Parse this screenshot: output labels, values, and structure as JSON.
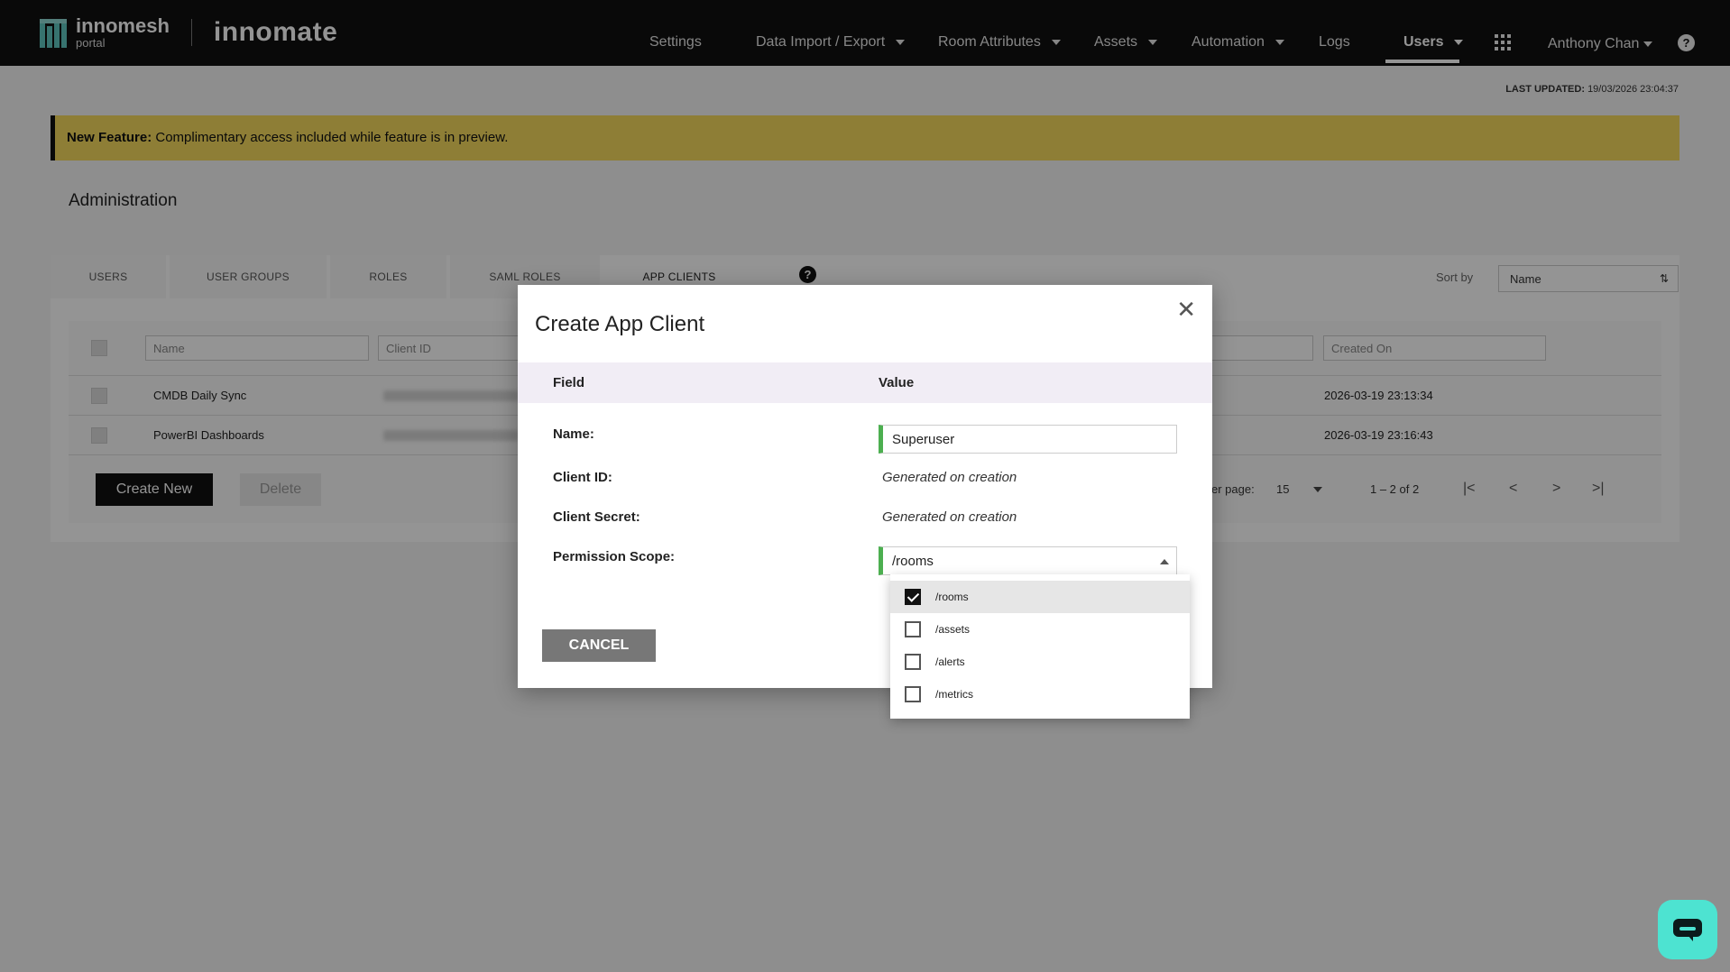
{
  "brand": {
    "logo_name": "innomesh",
    "logo_sub": "portal",
    "product": "innomate"
  },
  "nav": {
    "items": [
      {
        "label": "Settings"
      },
      {
        "label": "Data Import / Export"
      },
      {
        "label": "Room Attributes"
      },
      {
        "label": "Assets"
      },
      {
        "label": "Automation"
      },
      {
        "label": "Logs"
      },
      {
        "label": "Users"
      }
    ],
    "user": "Anthony Chan",
    "help": "?"
  },
  "last_updated": {
    "label": "LAST UPDATED:",
    "value": "19/03/2026 23:04:37"
  },
  "banner": {
    "title": "New Feature:",
    "text": "Complimentary access included while feature is in preview."
  },
  "page_title": "Administration",
  "tabs": [
    {
      "label": "USERS"
    },
    {
      "label": "USER GROUPS"
    },
    {
      "label": "ROLES"
    },
    {
      "label": "SAML ROLES"
    },
    {
      "label": "APP CLIENTS"
    }
  ],
  "sort": {
    "label": "Sort by",
    "value": "Name"
  },
  "table": {
    "filters": {
      "name": "Name",
      "client_id": "Client ID",
      "created_on": "Created On"
    },
    "rows": [
      {
        "name": "CMDB Daily Sync",
        "created_on": "2026-03-19 23:13:34"
      },
      {
        "name": "PowerBI Dashboards",
        "created_on": "2026-03-19 23:16:43"
      }
    ],
    "create_label": "Create New",
    "delete_label": "Delete",
    "per_page_label": "er page:",
    "per_page_value": "15",
    "range": "1 – 2 of 2"
  },
  "modal": {
    "title": "Create App Client",
    "head_field": "Field",
    "head_value": "Value",
    "name_label": "Name:",
    "name_value": "Superuser",
    "client_id_label": "Client ID:",
    "client_id_value": "Generated on creation",
    "client_secret_label": "Client Secret:",
    "client_secret_value": "Generated on creation",
    "scope_label": "Permission Scope:",
    "scope_value": "/rooms",
    "cancel_label": "CANCEL",
    "scope_options": [
      {
        "label": "/rooms",
        "checked": true
      },
      {
        "label": "/assets",
        "checked": false
      },
      {
        "label": "/alerts",
        "checked": false
      },
      {
        "label": "/metrics",
        "checked": false
      }
    ]
  },
  "colors": {
    "banner": "#f4da5e",
    "accent_green": "#4caf50",
    "chat": "#4de3d1",
    "topbar": "#111111"
  }
}
